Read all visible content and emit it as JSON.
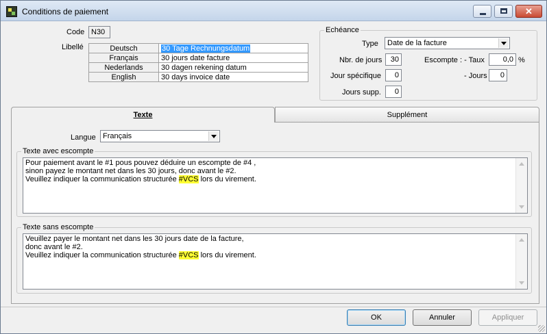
{
  "window": {
    "title": "Conditions de paiement"
  },
  "code": {
    "label": "Code",
    "value": "N30"
  },
  "libelle": {
    "label": "Libellé",
    "rows": [
      {
        "lang": "Deutsch",
        "value": "30 Tage Rechnungsdatum"
      },
      {
        "lang": "Français",
        "value": "30 jours date facture"
      },
      {
        "lang": "Nederlands",
        "value": "30 dagen rekening datum"
      },
      {
        "lang": "English",
        "value": "30 days invoice date"
      }
    ]
  },
  "echeance": {
    "title": "Echéance",
    "type_label": "Type",
    "type_value": "Date de la facture",
    "nbr_jours_label": "Nbr. de jours",
    "nbr_jours_value": "30",
    "escompte_taux_label": "Escompte : - Taux",
    "escompte_taux_value": "0,0",
    "percent": "%",
    "jour_specifique_label": "Jour spécifique",
    "jour_specifique_value": "0",
    "jours_label": "- Jours",
    "jours_value": "0",
    "jours_supp_label": "Jours supp.",
    "jours_supp_value": "0"
  },
  "tabs": [
    {
      "label": "Texte",
      "active": true
    },
    {
      "label": "Supplément",
      "active": false
    }
  ],
  "langue": {
    "label": "Langue",
    "value": "Français"
  },
  "texte_avec_escompte": {
    "title": "Texte avec escompte",
    "lines": [
      "Pour paiement avant le #1 pous pouvez déduire un escompte de #4 ,",
      "sinon payez le montant net dans les 30 jours, donc avant le #2."
    ],
    "line3_before": "Veuillez indiquer la communication structurée ",
    "line3_highlight": "#VCS",
    "line3_after": " lors du virement."
  },
  "texte_sans_escompte": {
    "title": "Texte sans escompte",
    "lines": [
      "Veuillez payer le montant net dans les 30 jours date de la facture,",
      "donc avant le #2."
    ],
    "line3_before": "Veuillez indiquer la communication structurée ",
    "line3_highlight": "#VCS",
    "line3_after": " lors du virement."
  },
  "buttons": {
    "ok": "OK",
    "annuler": "Annuler",
    "appliquer": "Appliquer"
  },
  "colors": {
    "highlight": "#ffff33",
    "selection": "#3399ff"
  }
}
